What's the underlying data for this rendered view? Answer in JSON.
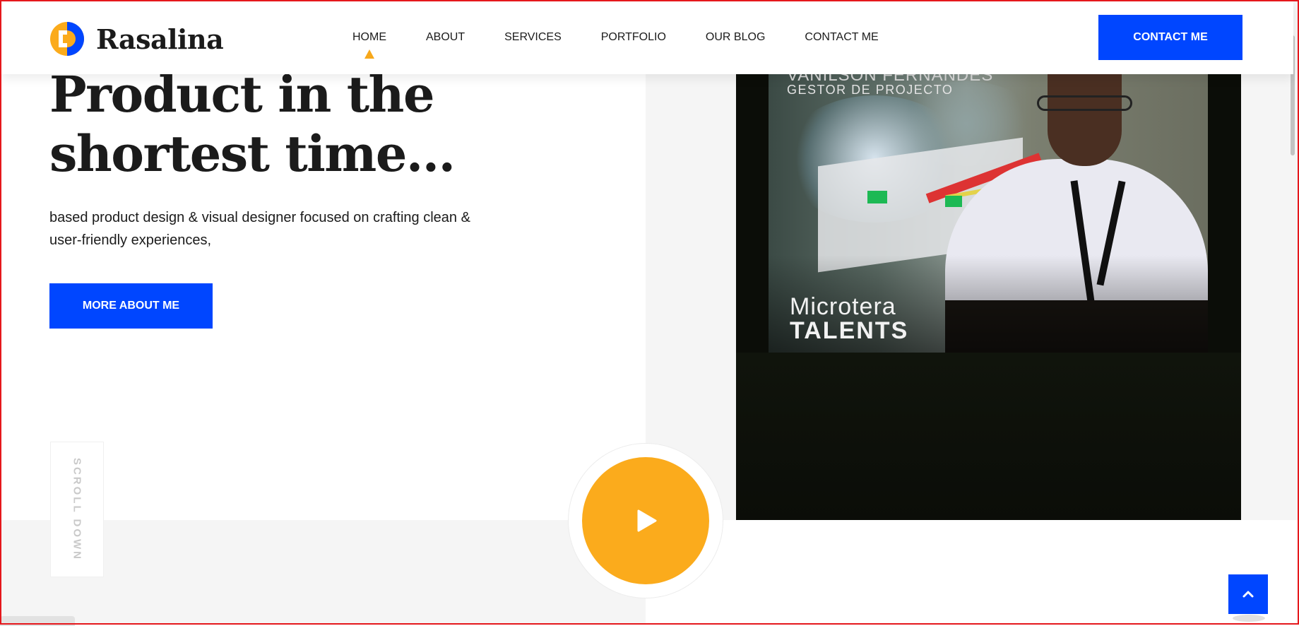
{
  "brand": {
    "name": "Rasalina",
    "logo_icon": "rasalina-r-logo-icon",
    "colors": {
      "accent_blue": "#0046ff",
      "accent_yellow": "#fbab1c",
      "text": "#1b1b1b"
    }
  },
  "nav": {
    "items": [
      {
        "label": "HOME",
        "active": true
      },
      {
        "label": "ABOUT"
      },
      {
        "label": "SERVICES"
      },
      {
        "label": "PORTFOLIO"
      },
      {
        "label": "OUR BLOG"
      },
      {
        "label": "CONTACT ME"
      }
    ],
    "cta_label": "CONTACT ME"
  },
  "hero": {
    "title_line1": "Product in the",
    "title_line2": "shortest time...",
    "description": "based product design & visual designer focused on crafting clean & user-friendly experiences,",
    "button_label": "MORE ABOUT ME",
    "scroll_label": "SCROLL DOWN"
  },
  "video": {
    "person_name": "VANILSON FERNANDES",
    "person_role": "GESTOR DE PROJECTO",
    "brand_line1": "Microtera",
    "brand_line2": "TALENTS",
    "play_icon": "play-icon"
  },
  "back_to_top_icon": "chevron-up-icon"
}
